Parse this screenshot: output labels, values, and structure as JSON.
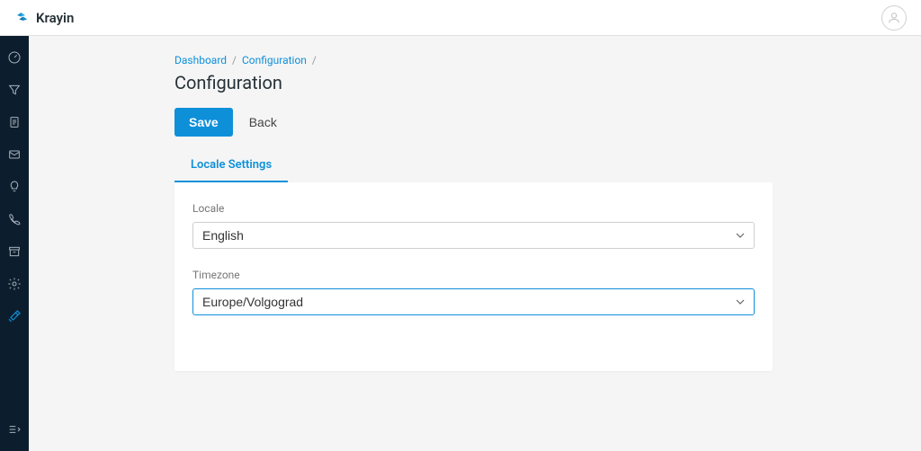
{
  "brand": "Krayin",
  "breadcrumb": {
    "items": [
      "Dashboard",
      "Configuration"
    ],
    "sep": "/"
  },
  "page_title": "Configuration",
  "actions": {
    "save": "Save",
    "back": "Back"
  },
  "tabs": {
    "locale": "Locale Settings"
  },
  "form": {
    "locale_label": "Locale",
    "locale_value": "English",
    "timezone_label": "Timezone",
    "timezone_value": "Europe/Volgograd"
  }
}
